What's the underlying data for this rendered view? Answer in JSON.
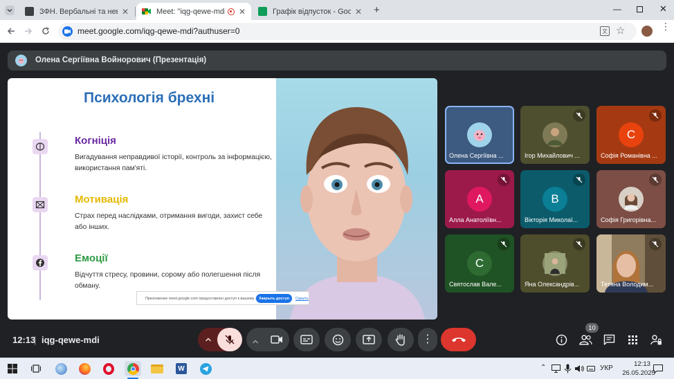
{
  "browser": {
    "tabs": [
      {
        "title": "ЗФН. Вербальні та невербаль",
        "favicon_color": "#3c4043",
        "active": false
      },
      {
        "title": "Meet: \"iqg-qewe-mdi\"",
        "favicon_color": "#00897b",
        "active": true
      },
      {
        "title": "Графік відпусток - Google Таб",
        "favicon_color": "#0f9d58",
        "active": false
      }
    ],
    "url": "meet.google.com/iqg-qewe-mdi?authuser=0"
  },
  "meet": {
    "presenter_banner": "Олена Сергіївна Войнорович (Презентація)",
    "slide": {
      "title": "Психологія брехні",
      "sections": [
        {
          "title": "Когніція",
          "text": "Вигадування неправдивої історії, контроль за інформацією, використання пам'яті.",
          "color": "#6a2aa0"
        },
        {
          "title": "Мотивація",
          "text": "Страх перед наслідками, отримання вигоди, захист себе або інших.",
          "color": "#e5b800"
        },
        {
          "title": "Емоції",
          "text": "Відчуття стресу, провини, сорому або полегшення після обману.",
          "color": "#2e9b45"
        }
      ],
      "popup": {
        "text": "Приложение meet.google.com предоставлен доступ к вашему экрану",
        "button": "Закрыть доступ",
        "link": "Скрыть"
      }
    },
    "participants": [
      {
        "name": "Олена Сергіївна ...",
        "initial": "",
        "bg": "#3d5a80",
        "avatar_bg": "#9fd3ea",
        "muted": false,
        "highlight": true
      },
      {
        "name": "Ігор Михайлович ...",
        "initial": "",
        "bg": "#4e4f2e",
        "avatar_bg": "#7d7a55",
        "muted": true,
        "highlight": false
      },
      {
        "name": "Софія Романівна ...",
        "initial": "С",
        "bg": "#a53a12",
        "avatar_bg": "#e8430e",
        "muted": true,
        "highlight": false
      },
      {
        "name": "Алла Анатоліївн...",
        "initial": "А",
        "bg": "#9c1a4a",
        "avatar_bg": "#e0185f",
        "muted": true,
        "highlight": false
      },
      {
        "name": "Вікторія Миколаї...",
        "initial": "В",
        "bg": "#0b5b6b",
        "avatar_bg": "#0a7f96",
        "muted": true,
        "highlight": false
      },
      {
        "name": "Софія Григорівна...",
        "initial": "",
        "bg": "#7c4e45",
        "avatar_bg": "#d8cfc6",
        "muted": true,
        "highlight": false
      },
      {
        "name": "Святослав Вале...",
        "initial": "С",
        "bg": "#1f5224",
        "avatar_bg": "#2e6b32",
        "muted": true,
        "highlight": false
      },
      {
        "name": "Яна Олександрів...",
        "initial": "",
        "bg": "#4e4d2c",
        "avatar_bg": "#8a8c6a",
        "muted": true,
        "highlight": false
      },
      {
        "name": "Тетяна Володим...",
        "initial": "",
        "bg": "#6b5a40",
        "avatar_bg": "#a88e6c",
        "muted": true,
        "highlight": false
      }
    ],
    "clock": "12:13",
    "meeting_code": "iqg-qewe-mdi",
    "people_count": "10"
  },
  "taskbar": {
    "language": "УКР",
    "time": "12:13",
    "date": "26.05.2025"
  }
}
